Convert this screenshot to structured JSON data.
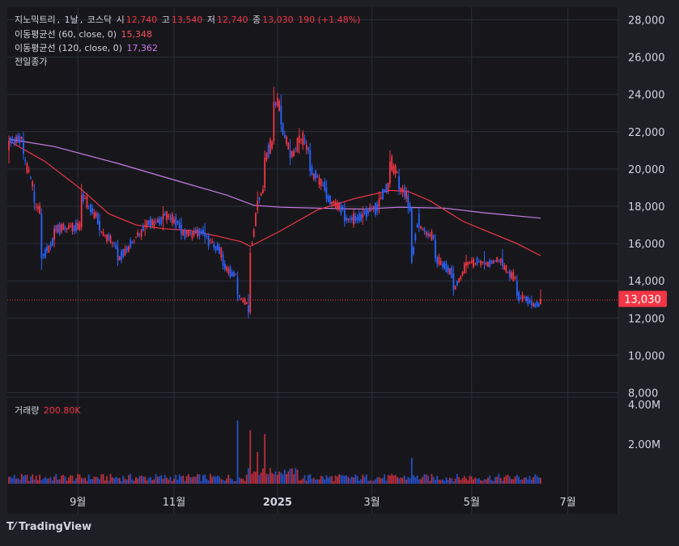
{
  "legend": {
    "symbol": "지노믹트리",
    "interval": "1날",
    "exchange": "코스닥",
    "open_label": "시",
    "open": "12,740",
    "high_label": "고",
    "high": "13,540",
    "low_label": "저",
    "low": "12,740",
    "close_label": "종",
    "close": "13,030",
    "change": "190 (+1.48%)",
    "ma60_label": "이동평균선 (60, close, 0)",
    "ma60_value": "15,348",
    "ma120_label": "이동평균선 (120, close, 0)",
    "ma120_value": "17,362",
    "prev_close_label": "전일종가",
    "volume_label": "거래량",
    "volume_value": "200.80K"
  },
  "price_tag": "13,030",
  "brand": "TradingView",
  "colors": {
    "background": "#1e1f24",
    "up": "#f23645",
    "down": "#2962ff",
    "ma60": "#f23645",
    "ma120": "#c77de6",
    "grid": "#2a2e39",
    "text": "#d1d4dc"
  },
  "chart_data": {
    "type": "candlestick",
    "price_axis": {
      "ticks": [
        "28,000",
        "26,000",
        "24,000",
        "22,000",
        "20,000",
        "18,000",
        "16,000",
        "14,000",
        "12,000",
        "10,000",
        "8,000"
      ],
      "ylim": [
        8000,
        28000
      ]
    },
    "volume_axis": {
      "ticks": [
        "4.00M",
        "2.00M"
      ],
      "ylim": [
        0,
        4000000
      ]
    },
    "x_axis": {
      "ticks": [
        "9월",
        "11월",
        "2025",
        "3월",
        "5월",
        "7월"
      ]
    },
    "last_close": 13030,
    "ohlc_keypoints": [
      {
        "t": 0,
        "o": 21000,
        "h": 21800,
        "l": 20300,
        "c": 21500
      },
      {
        "t": 8,
        "o": 21600,
        "h": 22000,
        "l": 20500,
        "c": 20800
      },
      {
        "t": 14,
        "o": 18800,
        "h": 19200,
        "l": 17800,
        "c": 18200
      },
      {
        "t": 18,
        "o": 17600,
        "h": 17900,
        "l": 14600,
        "c": 15200
      },
      {
        "t": 25,
        "o": 16200,
        "h": 17000,
        "l": 15800,
        "c": 16800
      },
      {
        "t": 40,
        "o": 16900,
        "h": 19200,
        "l": 16700,
        "c": 18600
      },
      {
        "t": 50,
        "o": 17200,
        "h": 17600,
        "l": 16400,
        "c": 16700
      },
      {
        "t": 60,
        "o": 15800,
        "h": 16200,
        "l": 14800,
        "c": 15100
      },
      {
        "t": 75,
        "o": 16900,
        "h": 17300,
        "l": 16400,
        "c": 17000
      },
      {
        "t": 85,
        "o": 17300,
        "h": 18000,
        "l": 16700,
        "c": 17600
      },
      {
        "t": 95,
        "o": 17000,
        "h": 17400,
        "l": 16200,
        "c": 16500
      },
      {
        "t": 108,
        "o": 16600,
        "h": 17100,
        "l": 16000,
        "c": 16400
      },
      {
        "t": 118,
        "o": 15400,
        "h": 15600,
        "l": 14600,
        "c": 14800
      },
      {
        "t": 126,
        "o": 14200,
        "h": 14500,
        "l": 12900,
        "c": 13300
      },
      {
        "t": 132,
        "o": 12700,
        "h": 13300,
        "l": 12000,
        "c": 12300
      },
      {
        "t": 133,
        "o": 12300,
        "h": 15800,
        "l": 12200,
        "c": 15500
      },
      {
        "t": 137,
        "o": 17800,
        "h": 18800,
        "l": 17600,
        "c": 18300
      },
      {
        "t": 141,
        "o": 19000,
        "h": 21000,
        "l": 18800,
        "c": 20600
      },
      {
        "t": 146,
        "o": 21500,
        "h": 24400,
        "l": 21300,
        "c": 23600
      },
      {
        "t": 150,
        "o": 23400,
        "h": 24000,
        "l": 22000,
        "c": 22400
      },
      {
        "t": 155,
        "o": 21000,
        "h": 21600,
        "l": 20200,
        "c": 20600
      },
      {
        "t": 160,
        "o": 21400,
        "h": 22200,
        "l": 20800,
        "c": 21800
      },
      {
        "t": 166,
        "o": 21000,
        "h": 21400,
        "l": 19600,
        "c": 19900
      },
      {
        "t": 175,
        "o": 19000,
        "h": 19400,
        "l": 18200,
        "c": 18400
      },
      {
        "t": 185,
        "o": 17800,
        "h": 18200,
        "l": 16900,
        "c": 17200
      },
      {
        "t": 195,
        "o": 17400,
        "h": 18000,
        "l": 17000,
        "c": 17600
      },
      {
        "t": 204,
        "o": 18000,
        "h": 18800,
        "l": 17600,
        "c": 18400
      },
      {
        "t": 210,
        "o": 19200,
        "h": 21000,
        "l": 19000,
        "c": 20400
      },
      {
        "t": 215,
        "o": 19600,
        "h": 20000,
        "l": 18600,
        "c": 18900
      },
      {
        "t": 220,
        "o": 18600,
        "h": 18900,
        "l": 17600,
        "c": 17900
      },
      {
        "t": 222,
        "o": 17900,
        "h": 17950,
        "l": 14900,
        "c": 15000
      },
      {
        "t": 226,
        "o": 17600,
        "h": 17900,
        "l": 16600,
        "c": 16900
      },
      {
        "t": 235,
        "o": 16200,
        "h": 16500,
        "l": 15000,
        "c": 15200
      },
      {
        "t": 245,
        "o": 14400,
        "h": 14800,
        "l": 13200,
        "c": 13500
      },
      {
        "t": 252,
        "o": 14800,
        "h": 15400,
        "l": 14400,
        "c": 15000
      },
      {
        "t": 262,
        "o": 15000,
        "h": 15600,
        "l": 14600,
        "c": 14900
      },
      {
        "t": 272,
        "o": 15200,
        "h": 15700,
        "l": 14600,
        "c": 14800
      },
      {
        "t": 280,
        "o": 14000,
        "h": 14300,
        "l": 13000,
        "c": 13200
      },
      {
        "t": 288,
        "o": 12900,
        "h": 13200,
        "l": 12500,
        "c": 12700
      },
      {
        "t": 293,
        "o": 12740,
        "h": 13540,
        "l": 12740,
        "c": 13030
      }
    ],
    "ma60_keypoints": [
      [
        0,
        21500
      ],
      [
        20,
        20400
      ],
      [
        40,
        18900
      ],
      [
        55,
        17600
      ],
      [
        70,
        17000
      ],
      [
        85,
        16800
      ],
      [
        100,
        16700
      ],
      [
        115,
        16400
      ],
      [
        128,
        16100
      ],
      [
        133,
        15850
      ],
      [
        150,
        16700
      ],
      [
        170,
        17800
      ],
      [
        190,
        18400
      ],
      [
        210,
        18850
      ],
      [
        220,
        18800
      ],
      [
        232,
        18300
      ],
      [
        250,
        17200
      ],
      [
        265,
        16600
      ],
      [
        280,
        16000
      ],
      [
        293,
        15348
      ]
    ],
    "ma120_keypoints": [
      [
        0,
        21600
      ],
      [
        25,
        21200
      ],
      [
        60,
        20300
      ],
      [
        95,
        19300
      ],
      [
        120,
        18600
      ],
      [
        135,
        18050
      ],
      [
        150,
        17950
      ],
      [
        170,
        17900
      ],
      [
        195,
        17850
      ],
      [
        215,
        17950
      ],
      [
        240,
        17900
      ],
      [
        262,
        17650
      ],
      [
        293,
        17362
      ]
    ],
    "volume_events": [
      {
        "t": 126,
        "v": 3200000
      },
      {
        "t": 133,
        "v": 2700000
      },
      {
        "t": 137,
        "v": 1600000
      },
      {
        "t": 141,
        "v": 2500000
      },
      {
        "t": 222,
        "v": 1300000
      }
    ]
  }
}
